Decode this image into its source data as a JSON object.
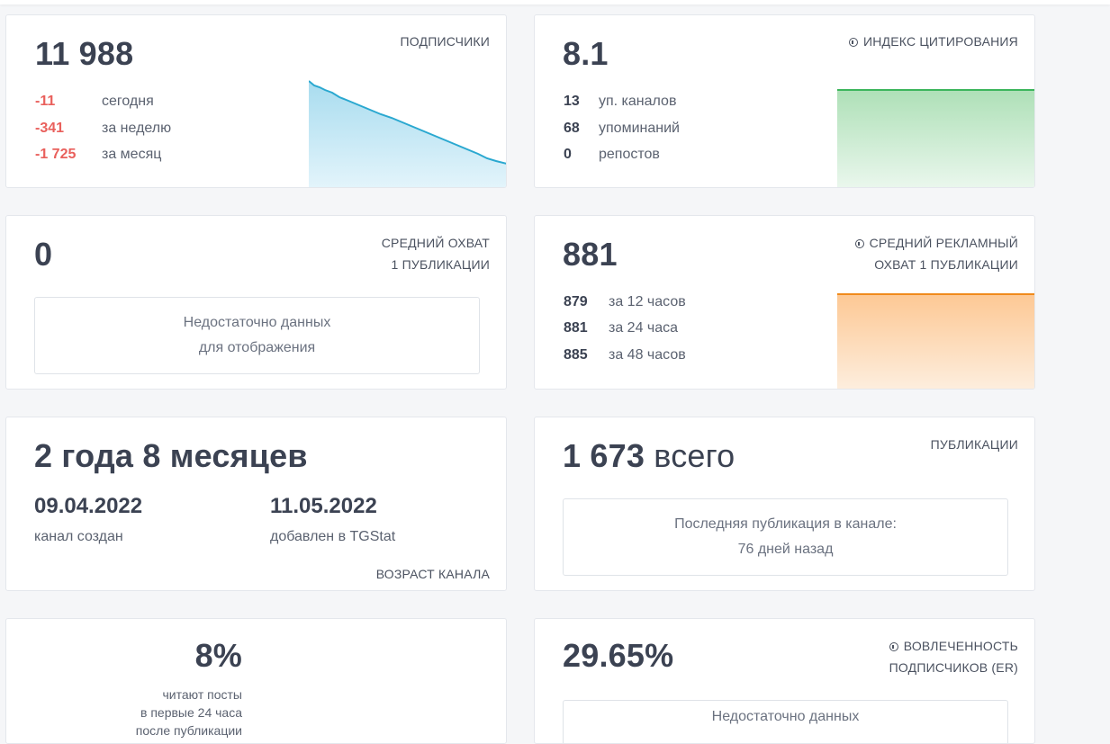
{
  "subscribers": {
    "value": "11 988",
    "label": "ПОДПИСЧИКИ",
    "rows": [
      {
        "num": "-11",
        "text": "сегодня"
      },
      {
        "num": "-341",
        "text": "за неделю"
      },
      {
        "num": "-1 725",
        "text": "за месяц"
      }
    ],
    "chart_color": "#2aa8d0"
  },
  "citation": {
    "value": "8.1",
    "label": "ИНДЕКС ЦИТИРОВАНИЯ",
    "icon": "info-circle-icon",
    "rows": [
      {
        "num": "13",
        "text": "уп. каналов"
      },
      {
        "num": "68",
        "text": "упоминаний"
      },
      {
        "num": "0",
        "text": "репостов"
      }
    ],
    "chart_color": "#3cb55c"
  },
  "avg_reach": {
    "value": "0",
    "label_line1": "СРЕДНИЙ ОХВАТ",
    "label_line2": "1 ПУБЛИКАЦИИ",
    "empty_line1": "Недостаточно данных",
    "empty_line2": "для отображения"
  },
  "ad_reach": {
    "value": "881",
    "label_line1": "СРЕДНИЙ РЕКЛАМНЫЙ",
    "label_line2": "ОХВАТ 1 ПУБЛИКАЦИИ",
    "icon": "info-circle-icon",
    "rows": [
      {
        "num": "879",
        "text": "за 12 часов"
      },
      {
        "num": "881",
        "text": "за 24 часа"
      },
      {
        "num": "885",
        "text": "за 48 часов"
      }
    ],
    "chart_color": "#f08a1c"
  },
  "age": {
    "value": "2 года 8 месяцев",
    "created_date": "09.04.2022",
    "created_label": "канал создан",
    "added_date": "11.05.2022",
    "added_label": "добавлен в TGStat",
    "label": "ВОЗРАСТ КАНАЛА"
  },
  "publications": {
    "value": "1 673",
    "value_suffix": "всего",
    "label": "ПУБЛИКАЦИИ",
    "last_line1": "Последняя публикация в канале:",
    "last_line2": "76 дней назад"
  },
  "read_24h": {
    "value": "8%",
    "line1": "читают посты",
    "line2": "в первые 24 часа",
    "line3": "после публикации"
  },
  "er": {
    "value": "29.65%",
    "label_line1": "ВОВЛЕЧЕННОСТЬ",
    "label_line2": "ПОДПИСЧИКОВ (ER)",
    "icon": "info-circle-icon",
    "empty_line1": "Недостаточно данных"
  }
}
